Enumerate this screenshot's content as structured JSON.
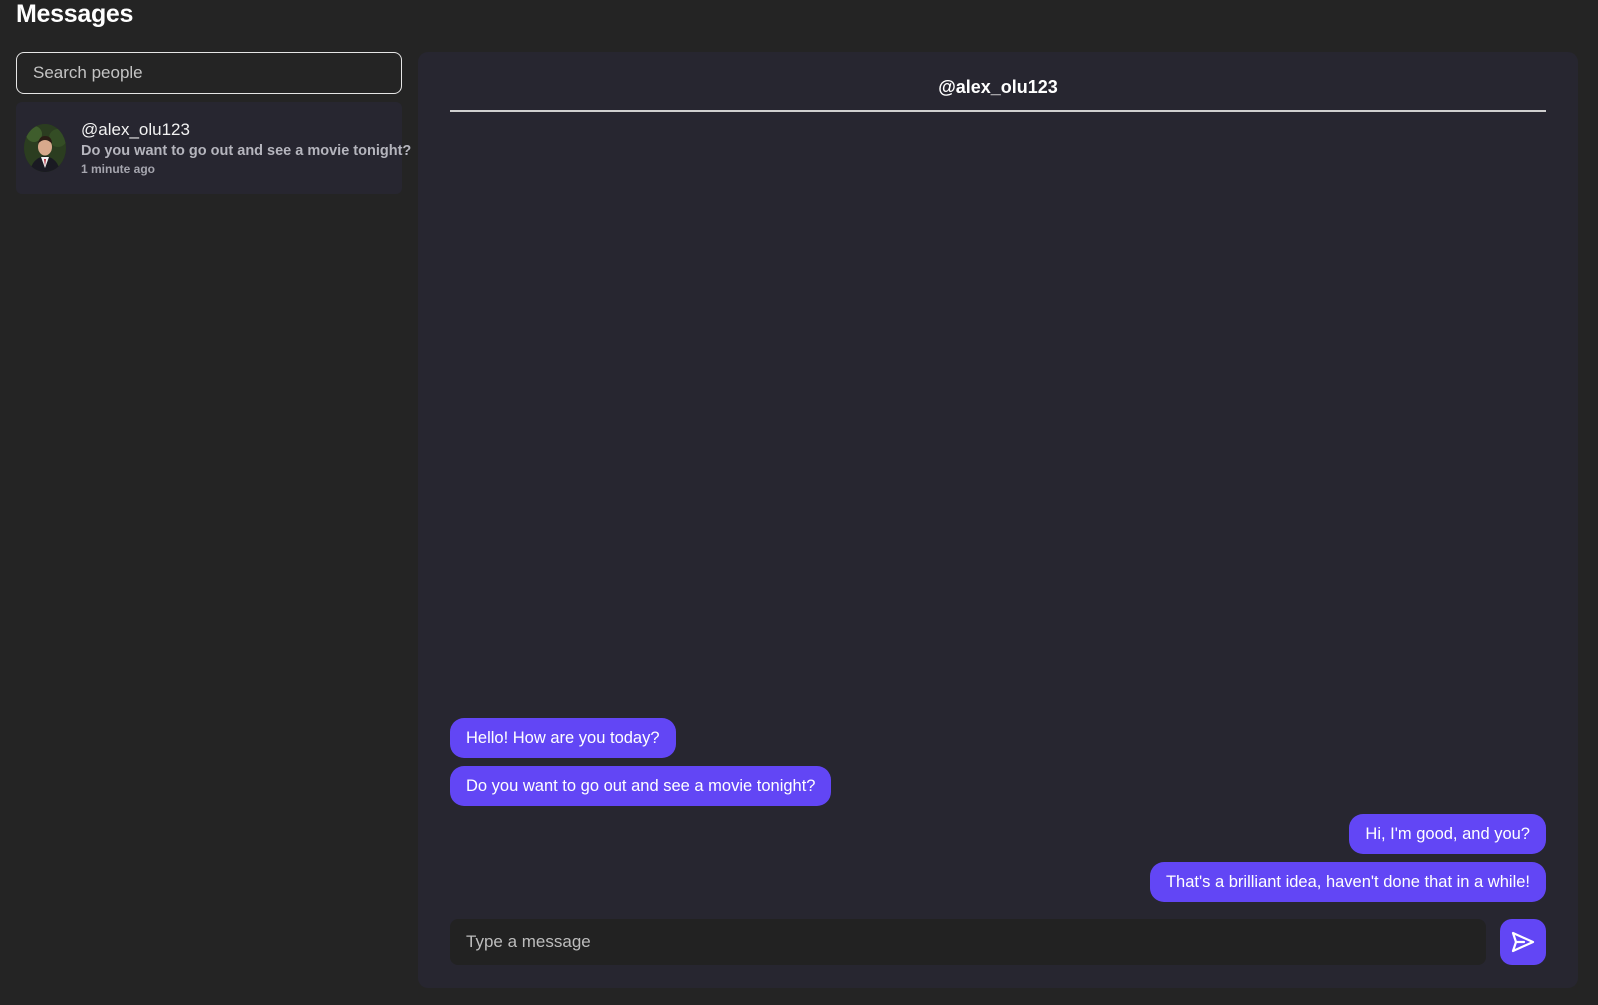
{
  "page": {
    "title": "Messages"
  },
  "search": {
    "placeholder": "Search people"
  },
  "conversations": [
    {
      "username": "@alex_olu123",
      "preview": "Do you want to go out and see a movie tonight?",
      "time": "1 minute ago"
    }
  ],
  "chat": {
    "header": "@alex_olu123",
    "messages": [
      {
        "side": "left",
        "text": "Hello! How are you today?"
      },
      {
        "side": "left",
        "text": "Do you want to go out and see a movie tonight?"
      },
      {
        "side": "right",
        "text": "Hi, I'm good, and you?"
      },
      {
        "side": "right",
        "text": "That's a brilliant idea, haven't done that in a while!"
      }
    ],
    "composer": {
      "placeholder": "Type a message"
    },
    "send_icon": "send-icon"
  },
  "colors": {
    "background": "#242424",
    "panel": "#272630",
    "accent": "#6246f5"
  }
}
